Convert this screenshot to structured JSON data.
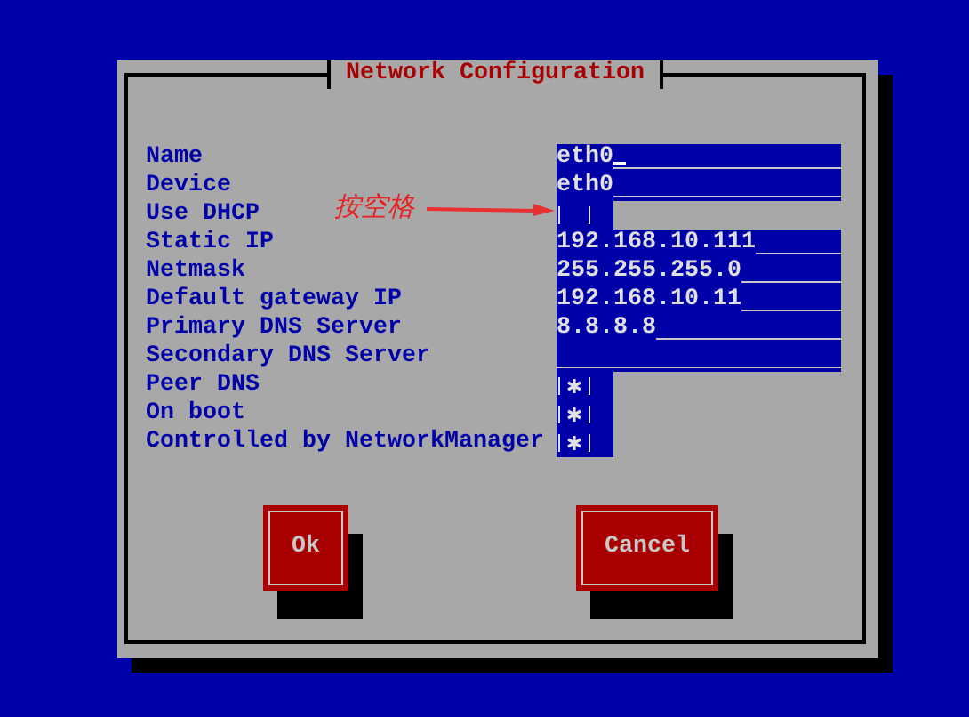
{
  "dialog": {
    "title": "Network Configuration"
  },
  "fields": [
    {
      "kind": "text",
      "label": "Name",
      "value": "eth0",
      "focused": true
    },
    {
      "kind": "text",
      "label": "Device",
      "value": "eth0"
    },
    {
      "kind": "checkbox",
      "label": "Use DHCP",
      "checked": false
    },
    {
      "kind": "text",
      "label": "Static IP",
      "value": "192.168.10.111"
    },
    {
      "kind": "text",
      "label": "Netmask",
      "value": "255.255.255.0"
    },
    {
      "kind": "text",
      "label": "Default gateway IP",
      "value": "192.168.10.11"
    },
    {
      "kind": "text",
      "label": "Primary DNS Server",
      "value": "8.8.8.8"
    },
    {
      "kind": "text",
      "label": "Secondary DNS Server"
    },
    {
      "kind": "checkbox",
      "label": "Peer DNS",
      "checked": true
    },
    {
      "kind": "checkbox",
      "label": "On boot",
      "checked": true
    },
    {
      "kind": "checkbox",
      "label": "Controlled by NetworkManager",
      "checked": true
    }
  ],
  "annotation": {
    "text": "按空格"
  },
  "buttons": [
    {
      "label": "Ok"
    },
    {
      "label": "Cancel"
    }
  ]
}
